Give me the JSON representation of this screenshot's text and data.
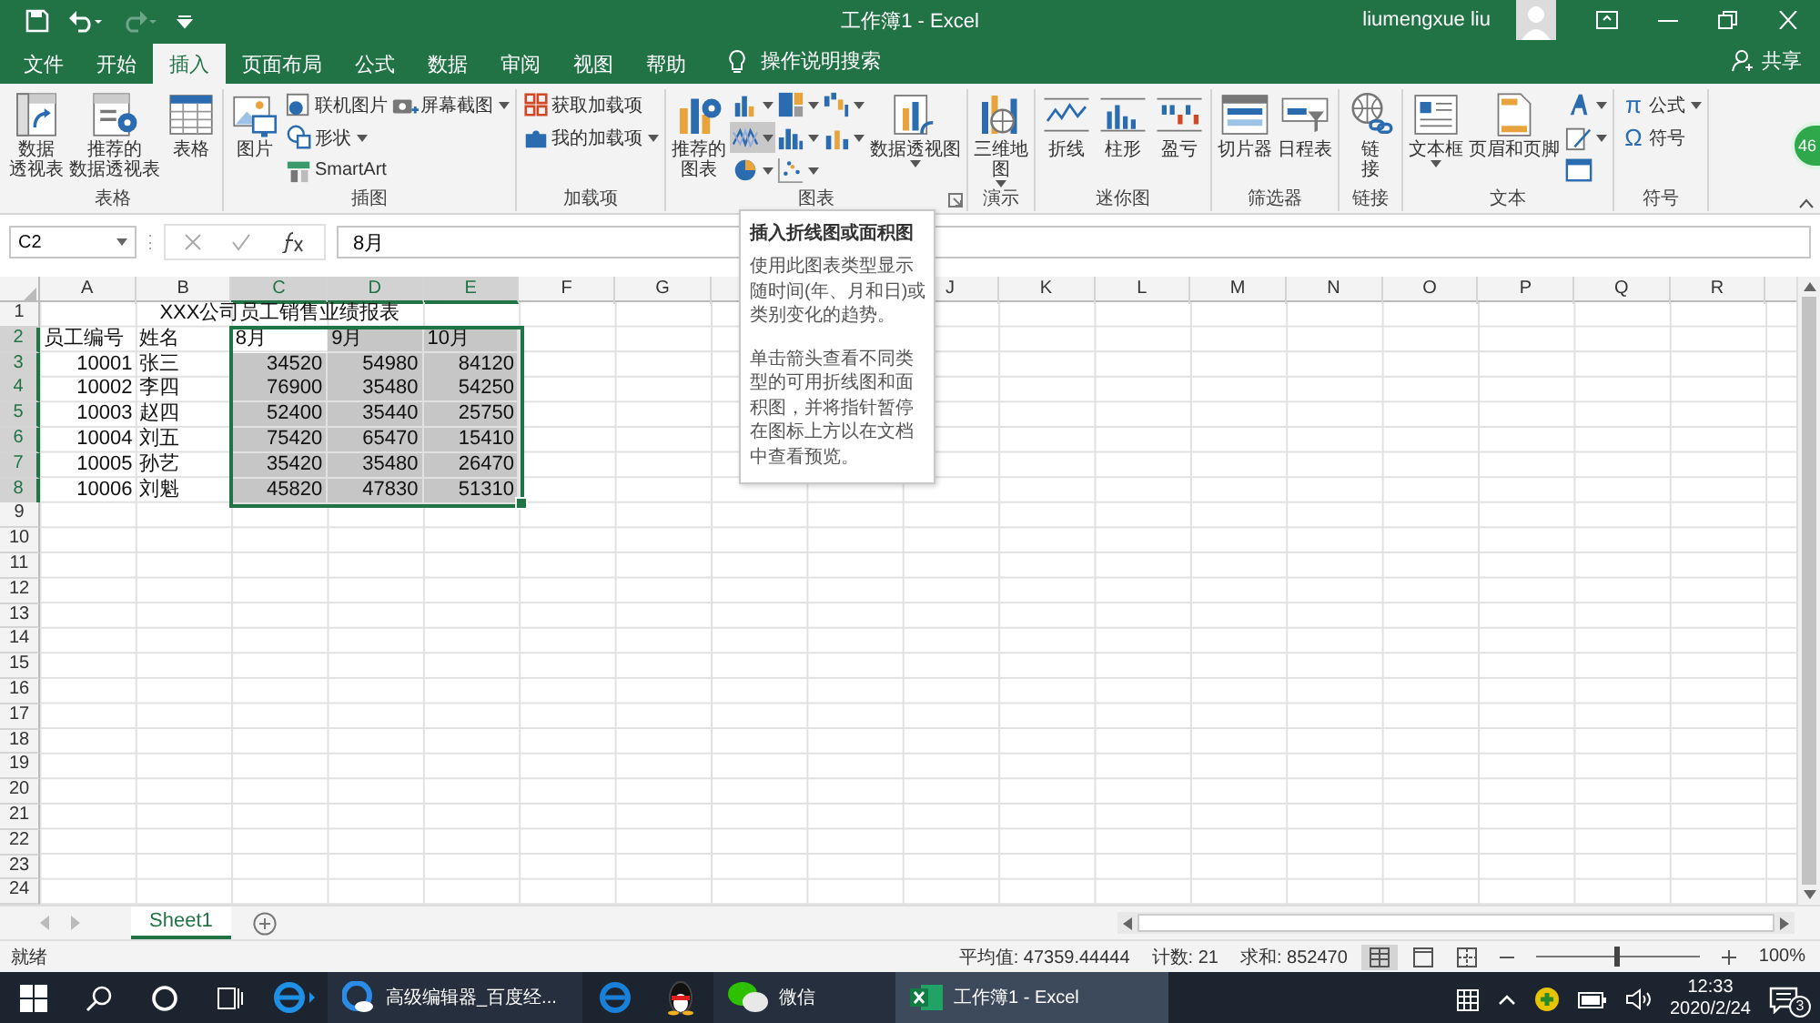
{
  "title_bar": {
    "quick_access": [
      {
        "kind": "save",
        "disabled": false
      },
      {
        "kind": "undo",
        "disabled": false
      },
      {
        "kind": "redo",
        "disabled": true
      },
      {
        "kind": "customize",
        "disabled": false
      }
    ],
    "title": "工作簿1 - Excel",
    "user": "liumengxue liu"
  },
  "ribbon_tabs": [
    {
      "label": "文件",
      "selected": false
    },
    {
      "label": "开始",
      "selected": false
    },
    {
      "label": "插入",
      "selected": true
    },
    {
      "label": "页面布局",
      "selected": false
    },
    {
      "label": "公式",
      "selected": false
    },
    {
      "label": "数据",
      "selected": false
    },
    {
      "label": "审阅",
      "selected": false
    },
    {
      "label": "视图",
      "selected": false
    },
    {
      "label": "帮助",
      "selected": false
    }
  ],
  "tell_me": "操作说明搜索",
  "share": "共享",
  "badge": "46",
  "ribbon_groups": [
    {
      "label": "表格",
      "items": [
        {
          "kind": "large",
          "lines": [
            "数据",
            "透视表"
          ],
          "dropdown": false
        },
        {
          "kind": "large",
          "lines": [
            "推荐的",
            "数据透视表"
          ],
          "dropdown": false
        },
        {
          "kind": "large",
          "lines": [
            "表格"
          ],
          "dropdown": false
        }
      ]
    },
    {
      "label": "插图",
      "items": [
        {
          "kind": "large",
          "lines": [
            "图片"
          ],
          "dropdown": false
        },
        {
          "kind": "small",
          "label": "联机图片",
          "dropdown": false
        },
        {
          "kind": "small",
          "label": "形状",
          "dropdown": true
        },
        {
          "kind": "small",
          "label": "SmartArt",
          "dropdown": false
        },
        {
          "kind": "small",
          "label": "屏幕截图",
          "dropdown": true
        }
      ]
    },
    {
      "label": "加载项",
      "items": [
        {
          "kind": "small",
          "label": "获取加载项",
          "dropdown": false
        },
        {
          "kind": "small",
          "label": "我的加载项",
          "dropdown": true
        }
      ]
    },
    {
      "label": "图表",
      "launcher": true,
      "items": [
        {
          "kind": "large",
          "lines": [
            "推荐的",
            "图表"
          ],
          "dropdown": false
        },
        {
          "kind": "icon",
          "dropdown": true,
          "highlighted": false
        },
        {
          "kind": "icon",
          "dropdown": true,
          "highlighted": true
        },
        {
          "kind": "icon",
          "dropdown": true,
          "highlighted": false
        },
        {
          "kind": "icon",
          "dropdown": true,
          "highlighted": false
        },
        {
          "kind": "icon",
          "dropdown": true,
          "highlighted": false
        },
        {
          "kind": "icon",
          "dropdown": true,
          "highlighted": false
        },
        {
          "kind": "icon",
          "dropdown": true,
          "highlighted": false
        },
        {
          "kind": "icon",
          "dropdown": true,
          "highlighted": false
        },
        {
          "kind": "large",
          "lines": [
            "数据透视图"
          ],
          "dropdown": true
        }
      ]
    },
    {
      "label": "演示",
      "items": [
        {
          "kind": "large",
          "lines": [
            "三维地",
            "图"
          ],
          "dropdown": true
        }
      ]
    },
    {
      "label": "迷你图",
      "items": [
        {
          "kind": "large",
          "lines": [
            "折线"
          ],
          "dropdown": false
        },
        {
          "kind": "large",
          "lines": [
            "柱形"
          ],
          "dropdown": false
        },
        {
          "kind": "large",
          "lines": [
            "盈亏"
          ],
          "dropdown": false
        }
      ]
    },
    {
      "label": "筛选器",
      "items": [
        {
          "kind": "large",
          "lines": [
            "切片器"
          ],
          "dropdown": false
        },
        {
          "kind": "large",
          "lines": [
            "日程表"
          ],
          "dropdown": false
        }
      ]
    },
    {
      "label": "链接",
      "items": [
        {
          "kind": "large",
          "lines": [
            "链",
            "接"
          ],
          "dropdown": false
        }
      ]
    },
    {
      "label": "文本",
      "items": [
        {
          "kind": "large",
          "lines": [
            "文本框"
          ],
          "dropdown": true
        },
        {
          "kind": "large",
          "lines": [
            "页眉和页脚"
          ],
          "dropdown": false
        },
        {
          "kind": "icon",
          "dropdown": true,
          "highlighted": false
        },
        {
          "kind": "icon",
          "dropdown": true,
          "highlighted": false
        },
        {
          "kind": "icon",
          "dropdown": false,
          "highlighted": false
        }
      ]
    },
    {
      "label": "符号",
      "items": [
        {
          "kind": "small",
          "glyph": "π",
          "label": "公式",
          "dropdown": true
        },
        {
          "kind": "small",
          "glyph": "Ω",
          "label": "符号",
          "dropdown": false
        }
      ]
    }
  ],
  "formula_bar": {
    "name_box": "C2",
    "formula": "8月"
  },
  "tooltip": {
    "title": "插入折线图或面积图",
    "paragraphs": [
      "使用此图表类型显示随时间(年、月和日)或类别变化的趋势。",
      "单击箭头查看不同类型的可用折线图和面积图，并将指针暂停在图标上方以在文档中查看预览。"
    ]
  },
  "sheet": {
    "columns": [
      {
        "label": "A",
        "selected": false
      },
      {
        "label": "B",
        "selected": false
      },
      {
        "label": "C",
        "selected": true
      },
      {
        "label": "D",
        "selected": true
      },
      {
        "label": "E",
        "selected": true
      },
      {
        "label": "F",
        "selected": false
      },
      {
        "label": "G",
        "selected": false
      },
      {},
      {},
      {
        "label": "J",
        "selected": false
      },
      {
        "label": "K",
        "selected": false
      },
      {
        "label": "L",
        "selected": false
      },
      {
        "label": "M",
        "selected": false
      },
      {
        "label": "N",
        "selected": false
      },
      {
        "label": "O",
        "selected": false
      },
      {
        "label": "P",
        "selected": false
      },
      {
        "label": "Q",
        "selected": false
      },
      {
        "label": "R",
        "selected": false
      }
    ],
    "rows": [
      {
        "number": "1",
        "selected": false,
        "cells": [
          {
            "kind": "title",
            "text": "XXX公司员工销售业绩报表",
            "selected": false
          }
        ]
      },
      {
        "number": "2",
        "selected": true,
        "cells": [
          {
            "kind": "text",
            "text": "员工编号",
            "selected": false
          },
          {
            "kind": "text",
            "text": "姓名",
            "selected": false
          },
          {
            "kind": "text",
            "text": "8月",
            "selected": false
          },
          {
            "kind": "text",
            "text": "9月",
            "selected": true
          },
          {
            "kind": "text",
            "text": "10月",
            "selected": true
          }
        ]
      },
      {
        "number": "3",
        "selected": true,
        "cells": [
          {
            "kind": "number",
            "text": "10001",
            "selected": false
          },
          {
            "kind": "text",
            "text": "张三",
            "selected": false
          },
          {
            "kind": "number",
            "text": "34520",
            "selected": true
          },
          {
            "kind": "number",
            "text": "54980",
            "selected": true
          },
          {
            "kind": "number",
            "text": "84120",
            "selected": true
          }
        ]
      },
      {
        "number": "4",
        "selected": true,
        "cells": [
          {
            "kind": "number",
            "text": "10002",
            "selected": false
          },
          {
            "kind": "text",
            "text": "李四",
            "selected": false
          },
          {
            "kind": "number",
            "text": "76900",
            "selected": true
          },
          {
            "kind": "number",
            "text": "35480",
            "selected": true
          },
          {
            "kind": "number",
            "text": "54250",
            "selected": true
          }
        ]
      },
      {
        "number": "5",
        "selected": true,
        "cells": [
          {
            "kind": "number",
            "text": "10003",
            "selected": false
          },
          {
            "kind": "text",
            "text": "赵四",
            "selected": false
          },
          {
            "kind": "number",
            "text": "52400",
            "selected": true
          },
          {
            "kind": "number",
            "text": "35440",
            "selected": true
          },
          {
            "kind": "number",
            "text": "25750",
            "selected": true
          }
        ]
      },
      {
        "number": "6",
        "selected": true,
        "cells": [
          {
            "kind": "number",
            "text": "10004",
            "selected": false
          },
          {
            "kind": "text",
            "text": "刘五",
            "selected": false
          },
          {
            "kind": "number",
            "text": "75420",
            "selected": true
          },
          {
            "kind": "number",
            "text": "65470",
            "selected": true
          },
          {
            "kind": "number",
            "text": "15410",
            "selected": true
          }
        ]
      },
      {
        "number": "7",
        "selected": true,
        "cells": [
          {
            "kind": "number",
            "text": "10005",
            "selected": false
          },
          {
            "kind": "text",
            "text": "孙艺",
            "selected": false
          },
          {
            "kind": "number",
            "text": "35420",
            "selected": true
          },
          {
            "kind": "number",
            "text": "35480",
            "selected": true
          },
          {
            "kind": "number",
            "text": "26470",
            "selected": true
          }
        ]
      },
      {
        "number": "8",
        "selected": true,
        "cells": [
          {
            "kind": "number",
            "text": "10006",
            "selected": false
          },
          {
            "kind": "text",
            "text": "刘魁",
            "selected": false
          },
          {
            "kind": "number",
            "text": "45820",
            "selected": true
          },
          {
            "kind": "number",
            "text": "47830",
            "selected": true
          },
          {
            "kind": "number",
            "text": "51310",
            "selected": true
          }
        ]
      },
      {
        "number": "9",
        "selected": false
      },
      {
        "number": "10",
        "selected": false
      },
      {
        "number": "11",
        "selected": false
      },
      {
        "number": "12",
        "selected": false
      },
      {
        "number": "13",
        "selected": false
      },
      {
        "number": "14",
        "selected": false
      },
      {
        "number": "15",
        "selected": false
      },
      {
        "number": "16",
        "selected": false
      },
      {
        "number": "17",
        "selected": false
      },
      {
        "number": "18",
        "selected": false
      },
      {
        "number": "19",
        "selected": false
      },
      {
        "number": "20",
        "selected": false
      },
      {
        "number": "21",
        "selected": false
      },
      {
        "number": "22",
        "selected": false
      },
      {
        "number": "23",
        "selected": false
      },
      {
        "number": "24",
        "selected": false
      }
    ]
  },
  "sheet_tabs": [
    {
      "label": "Sheet1",
      "selected": true
    }
  ],
  "status_bar": {
    "mode": "就绪",
    "average": "平均值: 47359.44444",
    "count": "计数: 21",
    "sum": "求和: 852470",
    "zoom": {
      "level": 0.5,
      "reading": "100%"
    }
  },
  "taskbar": {
    "system_buttons": [
      {
        "kind": "start"
      },
      {
        "kind": "search"
      },
      {
        "kind": "cortana"
      },
      {
        "kind": "task-view"
      }
    ],
    "apps": [
      {
        "kind": "ie",
        "running": false,
        "active": false
      },
      {
        "kind": "browser",
        "label": "高级编辑器_百度经...",
        "running": true,
        "active": false
      },
      {
        "kind": "edge",
        "running": false,
        "active": false
      },
      {
        "kind": "qq",
        "running": false,
        "active": false
      },
      {
        "kind": "wechat",
        "label": "微信",
        "running": true,
        "active": false
      },
      {
        "kind": "excel",
        "label": "工作簿1 - Excel",
        "running": true,
        "active": true
      }
    ],
    "time": "12:33",
    "date": "2020/2/24",
    "notifications": "3"
  }
}
